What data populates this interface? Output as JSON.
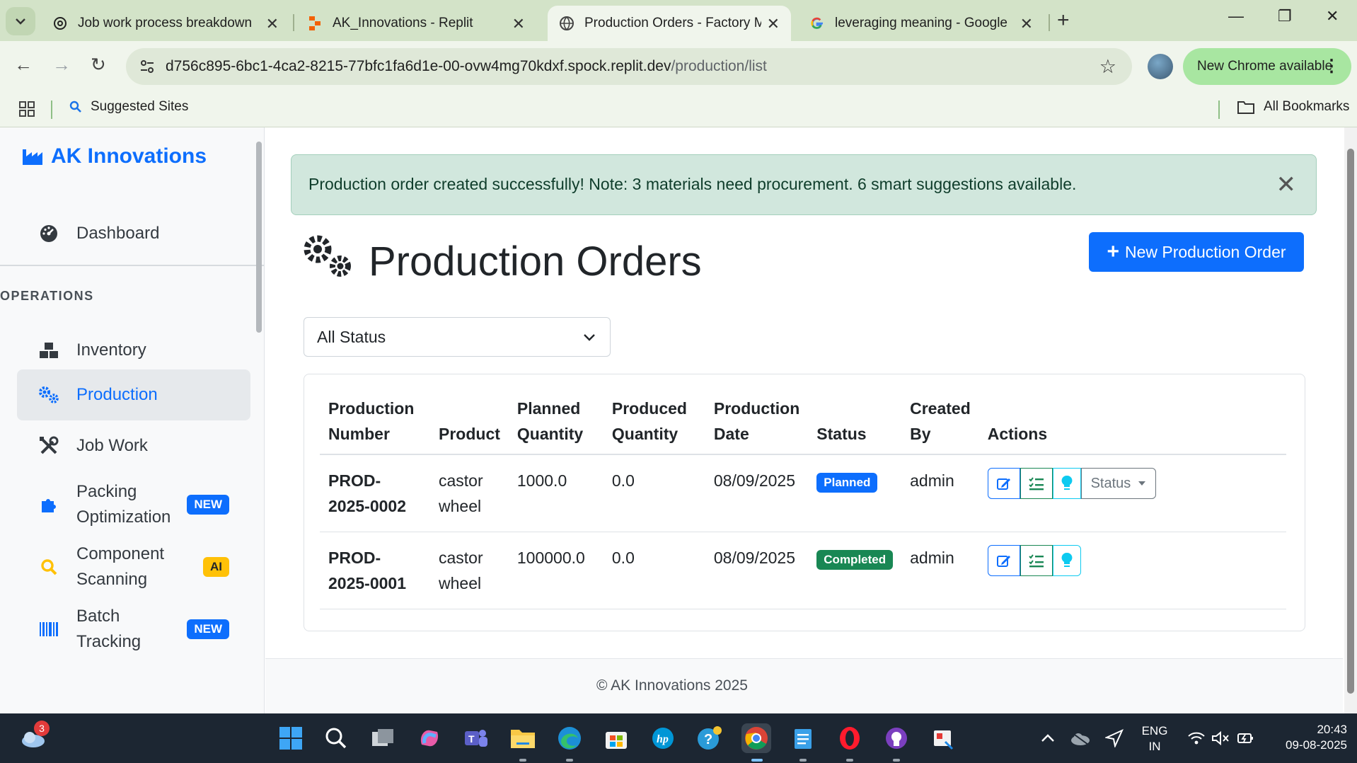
{
  "browser": {
    "tabs": [
      {
        "title": "Job work process breakdown",
        "icon": "chatgpt-icon"
      },
      {
        "title": "AK_Innovations - Replit",
        "icon": "replit-icon"
      },
      {
        "title": "Production Orders - Factory Ma",
        "icon": "globe-icon",
        "active": true
      },
      {
        "title": "leveraging meaning - Google S",
        "icon": "google-icon"
      }
    ],
    "url_host": "d756c895-6bc1-4ca2-8215-77bfc1fa6d1e-00-ovw4mg70kdxf.spock.replit.dev",
    "url_path": "/production/list",
    "update_label": "New Chrome available",
    "bookmarks": {
      "suggested": "Suggested Sites",
      "all": "All Bookmarks"
    }
  },
  "sidebar": {
    "brand": "AK Innovations",
    "dashboard": "Dashboard",
    "section": "OPERATIONS",
    "items": [
      {
        "label": "Inventory",
        "icon": "boxes-icon"
      },
      {
        "label": "Production",
        "icon": "gears-icon",
        "active": true
      },
      {
        "label": "Job Work",
        "icon": "tools-icon"
      },
      {
        "label": "Packing Optimization",
        "icon": "puzzle-icon",
        "badge": "NEW"
      },
      {
        "label": "Component Scanning",
        "icon": "search-icon",
        "badge": "AI"
      },
      {
        "label": "Batch Tracking",
        "icon": "barcode-icon",
        "badge": "NEW"
      }
    ]
  },
  "main": {
    "alert": "Production order created successfully! Note: 3 materials need procurement. 6 smart suggestions available.",
    "title": "Production Orders",
    "new_button": "New Production Order",
    "filter_value": "All Status",
    "table": {
      "headers": [
        "Production Number",
        "Product",
        "Planned Quantity",
        "Produced Quantity",
        "Production Date",
        "Status",
        "Created By",
        "Actions"
      ],
      "rows": [
        {
          "number": "PROD-2025-0002",
          "product": "castor wheel",
          "planned": "1000.0",
          "produced": "0.0",
          "date": "08/09/2025",
          "status": "Planned",
          "created_by": "admin"
        },
        {
          "number": "PROD-2025-0001",
          "product": "castor wheel",
          "planned": "100000.0",
          "produced": "0.0",
          "date": "08/09/2025",
          "status": "Completed",
          "created_by": "admin"
        }
      ],
      "status_dropdown": "Status"
    },
    "footer": "© AK Innovations 2025"
  },
  "taskbar": {
    "weather_badge": "3",
    "lang_line1": "ENG",
    "lang_line2": "IN",
    "time": "20:43",
    "date": "09-08-2025"
  },
  "colors": {
    "primary": "#0d6efd",
    "success": "#198754",
    "info": "#0dcaf0",
    "warning": "#ffc107",
    "alert_bg": "#d1e7dd",
    "chrome_frame": "#d3e3c8"
  }
}
